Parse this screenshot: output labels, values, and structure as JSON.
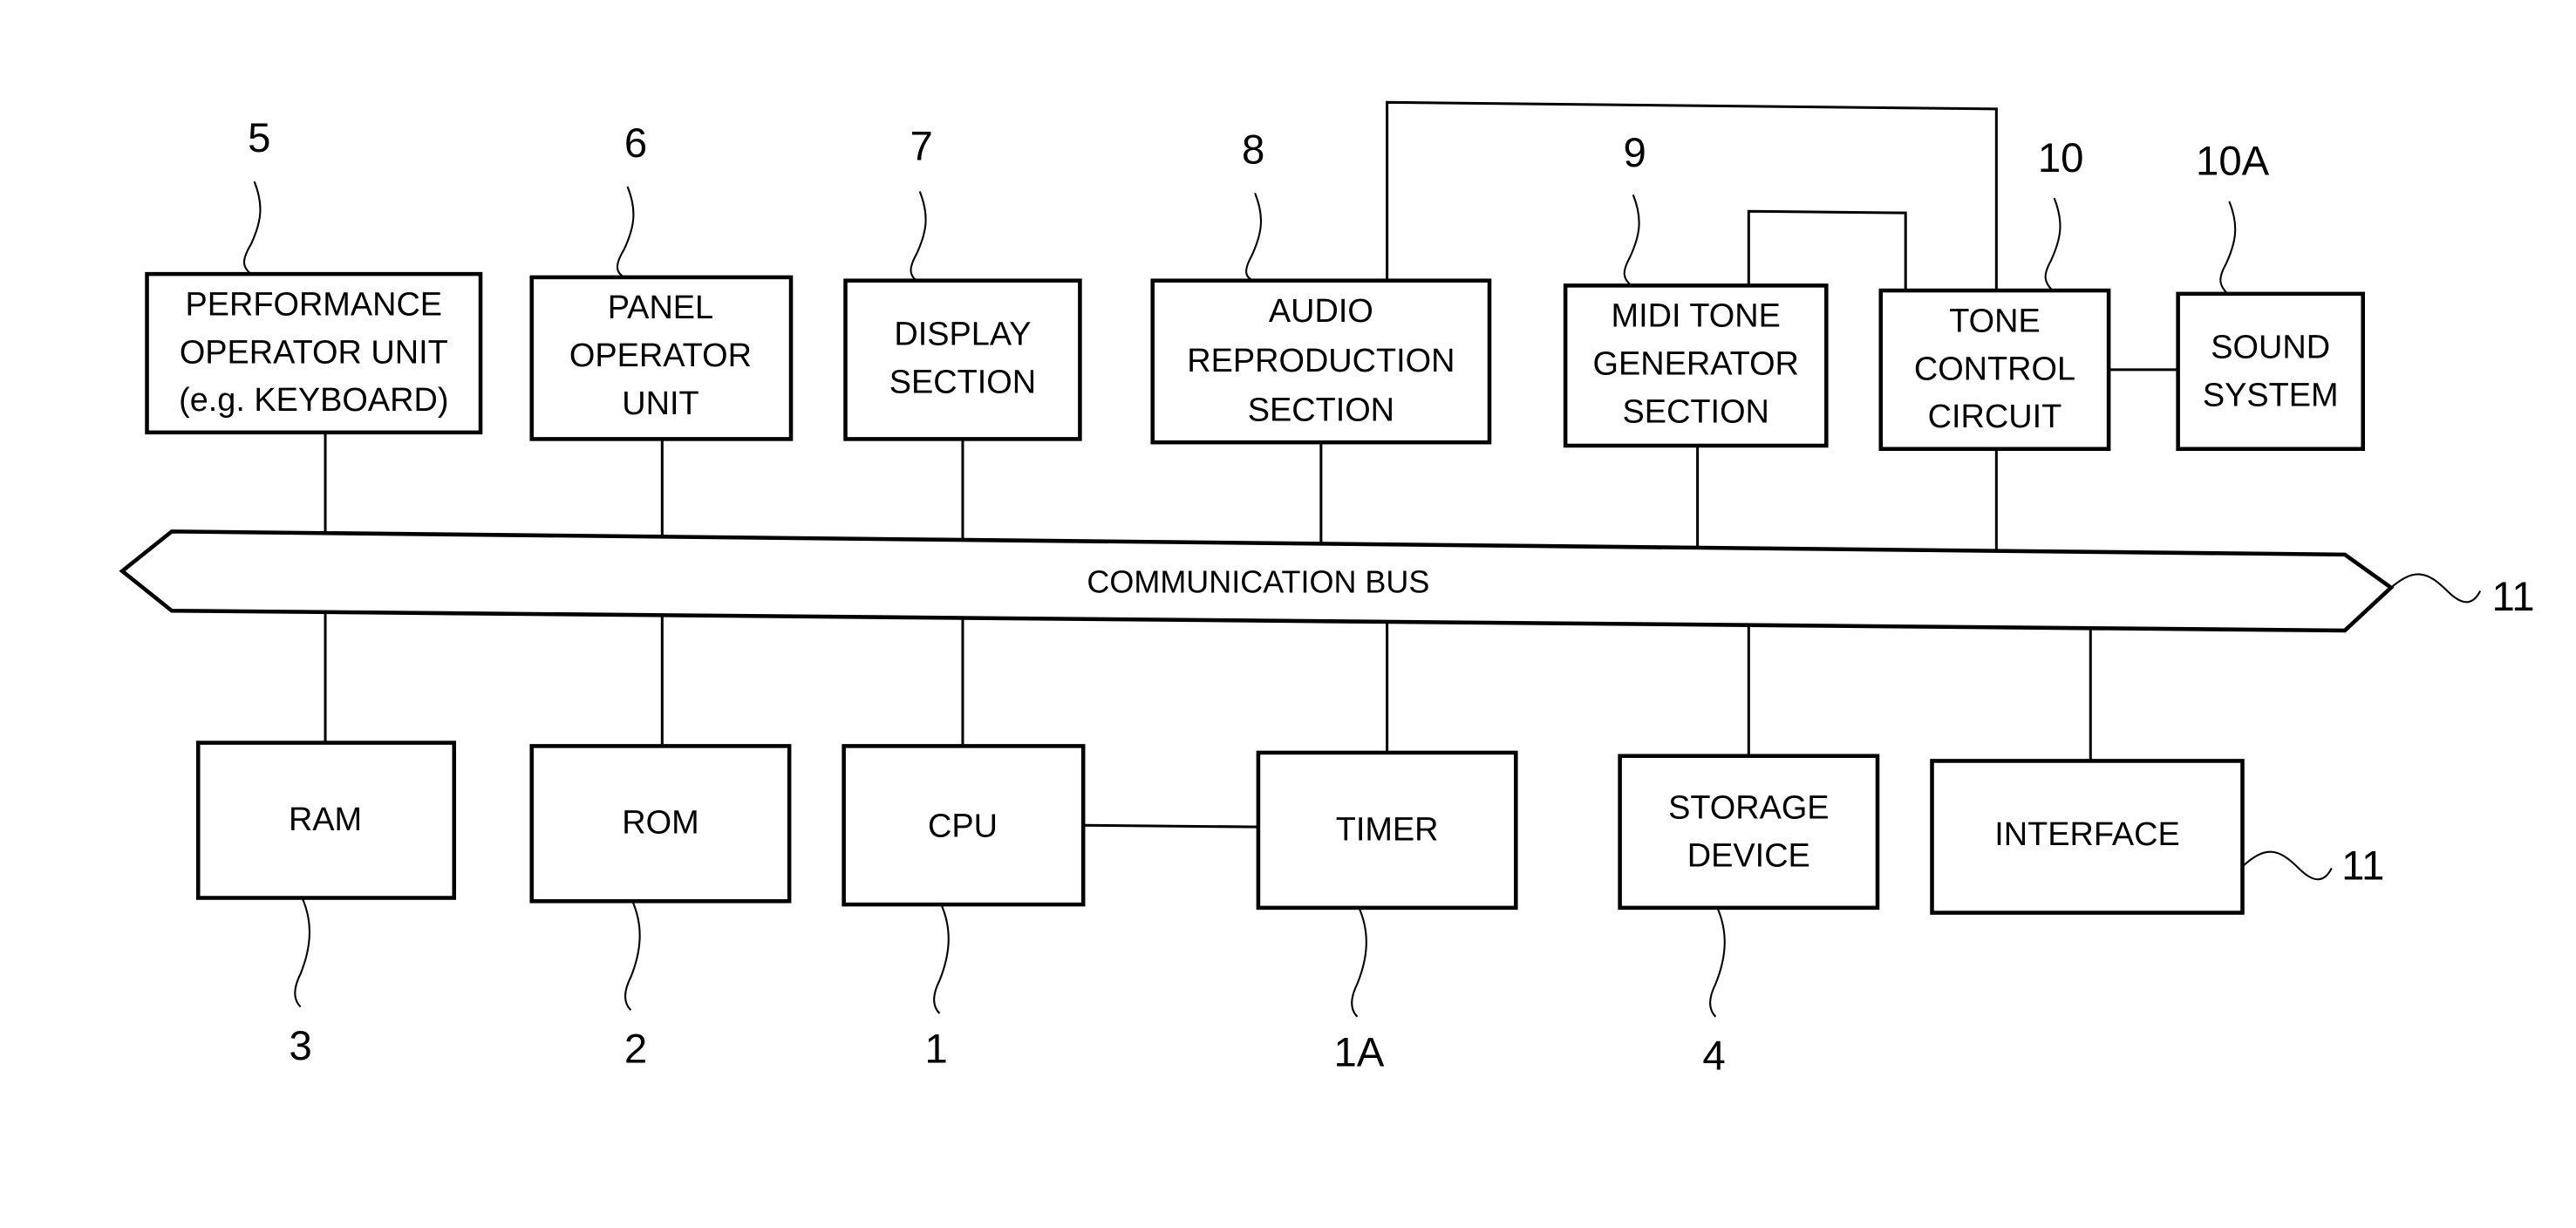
{
  "diagram": {
    "type": "block-diagram",
    "bus": {
      "label": "COMMUNICATION BUS",
      "ref": "11"
    },
    "top_blocks": [
      {
        "id": "performance-operator-unit",
        "ref": "5",
        "lines": [
          "PERFORMANCE",
          "OPERATOR UNIT",
          "(e.g. KEYBOARD)"
        ]
      },
      {
        "id": "panel-operator-unit",
        "ref": "6",
        "lines": [
          "PANEL",
          "OPERATOR",
          "UNIT"
        ]
      },
      {
        "id": "display-section",
        "ref": "7",
        "lines": [
          "DISPLAY",
          "SECTION"
        ]
      },
      {
        "id": "audio-reproduction-section",
        "ref": "8",
        "lines": [
          "AUDIO",
          "REPRODUCTION",
          "SECTION"
        ]
      },
      {
        "id": "midi-tone-generator-section",
        "ref": "9",
        "lines": [
          "MIDI TONE",
          "GENERATOR",
          "SECTION"
        ]
      },
      {
        "id": "tone-control-circuit",
        "ref": "10",
        "lines": [
          "TONE",
          "CONTROL",
          "CIRCUIT"
        ]
      },
      {
        "id": "sound-system",
        "ref": "10A",
        "lines": [
          "SOUND",
          "SYSTEM"
        ]
      }
    ],
    "bottom_blocks": [
      {
        "id": "ram",
        "ref": "3",
        "lines": [
          "RAM"
        ]
      },
      {
        "id": "rom",
        "ref": "2",
        "lines": [
          "ROM"
        ]
      },
      {
        "id": "cpu",
        "ref": "1",
        "lines": [
          "CPU"
        ]
      },
      {
        "id": "timer",
        "ref": "1A",
        "lines": [
          "TIMER"
        ]
      },
      {
        "id": "storage-device",
        "ref": "4",
        "lines": [
          "STORAGE",
          "DEVICE"
        ]
      },
      {
        "id": "interface",
        "ref": "11",
        "lines": [
          "INTERFACE"
        ]
      }
    ],
    "connections": [
      [
        "performance-operator-unit",
        "bus"
      ],
      [
        "panel-operator-unit",
        "bus"
      ],
      [
        "display-section",
        "bus"
      ],
      [
        "audio-reproduction-section",
        "bus"
      ],
      [
        "midi-tone-generator-section",
        "bus"
      ],
      [
        "tone-control-circuit",
        "bus"
      ],
      [
        "ram",
        "bus"
      ],
      [
        "rom",
        "bus"
      ],
      [
        "cpu",
        "bus"
      ],
      [
        "timer",
        "bus"
      ],
      [
        "storage-device",
        "bus"
      ],
      [
        "interface",
        "bus"
      ],
      [
        "cpu",
        "timer"
      ],
      [
        "tone-control-circuit",
        "sound-system"
      ],
      [
        "audio-reproduction-section",
        "tone-control-circuit"
      ],
      [
        "midi-tone-generator-section",
        "tone-control-circuit"
      ]
    ]
  }
}
